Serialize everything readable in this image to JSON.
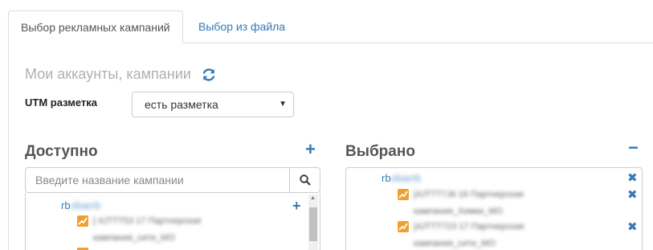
{
  "tabs": [
    {
      "label": "Выбор рекламных кампаний",
      "active": true
    },
    {
      "label": "Выбор из файла",
      "active": false
    }
  ],
  "section": {
    "title": "Мои аккаунты, кампании"
  },
  "utm": {
    "label": "UTM разметка",
    "value": "есть разметка"
  },
  "available": {
    "title": "Доступно",
    "search_placeholder": "Введите название кампании",
    "account": {
      "prefix": "rb",
      "masked": "obarrb"
    },
    "campaigns": [
      {
        "line1": "[ 4JTTT53 17 Партнерская",
        "line2": "кампания_сити_МО"
      }
    ]
  },
  "selected": {
    "title": "Выбрано",
    "account": {
      "prefix": "rb",
      "masked": "obarrb"
    },
    "campaigns": [
      {
        "line1": "[4JTTT7J6 16 Партнерская",
        "line2": "кампания_Химки_МО"
      },
      {
        "line1": "[4JTTT723 17 Партнерская",
        "line2": "кампания_сити_МО"
      }
    ]
  },
  "colors": {
    "accent": "#337ab7",
    "icon_orange": "#f0a030",
    "muted": "#b0b0b0"
  }
}
